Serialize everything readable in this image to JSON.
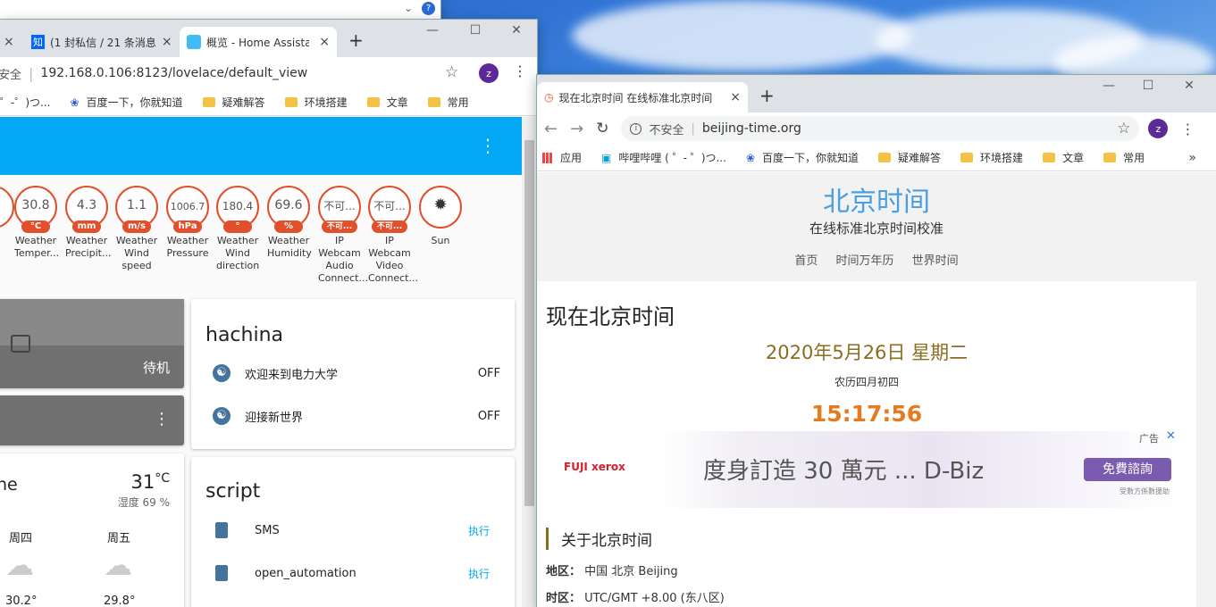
{
  "win1": {
    "tabs": [
      {
        "label": "",
        "close": "×"
      },
      {
        "icon": "知",
        "label": "(1 封私信 / 21 条消息",
        "close": "×"
      },
      {
        "label": "概览 - Home Assistant",
        "close": "×"
      }
    ],
    "new_tab": "+",
    "address": {
      "security": "安全",
      "url": "192.168.0.106:8123/lovelace/default_view"
    },
    "profile": "z",
    "bookmarks": [
      {
        "label": "゜-゜)つ..."
      },
      {
        "label": "百度一下，你就知道"
      },
      {
        "label": "疑难解答"
      },
      {
        "label": "环境搭建"
      },
      {
        "label": "文章"
      },
      {
        "label": "常用"
      }
    ],
    "gauges": [
      {
        "value": "",
        "unit": "",
        "name": "..."
      },
      {
        "value": "30.8",
        "unit": "°C",
        "name": "Weather Temper..."
      },
      {
        "value": "4.3",
        "unit": "mm",
        "name": "Weather Precipit..."
      },
      {
        "value": "1.1",
        "unit": "m/s",
        "name": "Weather Wind speed"
      },
      {
        "value": "1006.7",
        "unit": "hPa",
        "name": "Weather Pressure"
      },
      {
        "value": "180.4",
        "unit": "°",
        "name": "Weather Wind direction"
      },
      {
        "value": "69.6",
        "unit": "%",
        "name": "Weather Humidity"
      },
      {
        "value": "不可...",
        "unit": "不可...",
        "name": "IP Webcam Audio Connect..."
      },
      {
        "value": "不可...",
        "unit": "不可...",
        "name": "IP Webcam Video Connect..."
      },
      {
        "value": "",
        "unit": "",
        "name": "Sun"
      }
    ],
    "media": {
      "state": "待机"
    },
    "hachina": {
      "title": "hachina",
      "items": [
        {
          "label": "欢迎来到电力大学",
          "state": "OFF"
        },
        {
          "label": "迎接新世界",
          "state": "OFF"
        }
      ]
    },
    "weather": {
      "name": "ne",
      "temp": "31",
      "temp_unit": "°C",
      "humidity": "湿度 69 %",
      "days": [
        {
          "day": "周四",
          "temp": "30.2°"
        },
        {
          "day": "周五",
          "temp": "29.8°"
        }
      ]
    },
    "script": {
      "title": "script",
      "items": [
        {
          "label": "SMS",
          "action": "执行"
        },
        {
          "label": "open_automation",
          "action": "执行"
        }
      ]
    },
    "colors": {
      "header": "#03a9f4",
      "gauge": "#e14f2b",
      "icon": "#44739e"
    }
  },
  "win2": {
    "tab": {
      "label": "现在北京时间 在线标准北京时间",
      "close": "×"
    },
    "new_tab": "+",
    "address": {
      "security": "不安全",
      "url": "beijing-time.org"
    },
    "profile": "z",
    "bookmarks": [
      {
        "label": "应用"
      },
      {
        "label": "哔哩哔哩 ( ゜- ゜)つ..."
      },
      {
        "label": "百度一下，你就知道"
      },
      {
        "label": "疑难解答"
      },
      {
        "label": "环境搭建"
      },
      {
        "label": "文章"
      },
      {
        "label": "常用"
      }
    ],
    "site": {
      "title": "北京时间",
      "subtitle": "在线标准北京时间校准",
      "nav": [
        "首页",
        "时间万年历",
        "世界时间"
      ]
    },
    "main": {
      "heading": "现在北京时间",
      "date": "2020年5月26日 星期二",
      "lunar": "农历四月初四",
      "time": "15:17:56"
    },
    "ad": {
      "brand": "FUJI xerox",
      "text": "度身訂造 30 萬元 ... D-Biz",
      "cta": "免費諮詢",
      "label": "广告",
      "small": "受數方係數援助"
    },
    "about": {
      "heading": "关于北京时间",
      "region_k": "地区：",
      "region_v": "中国 北京 Beijing",
      "zone_k": "时区：",
      "zone_v": "UTC/GMT +8.00 (东八区)"
    },
    "colors": {
      "title": "#4a9fe0",
      "date": "#8c6d1f",
      "time": "#e57b1f"
    }
  }
}
